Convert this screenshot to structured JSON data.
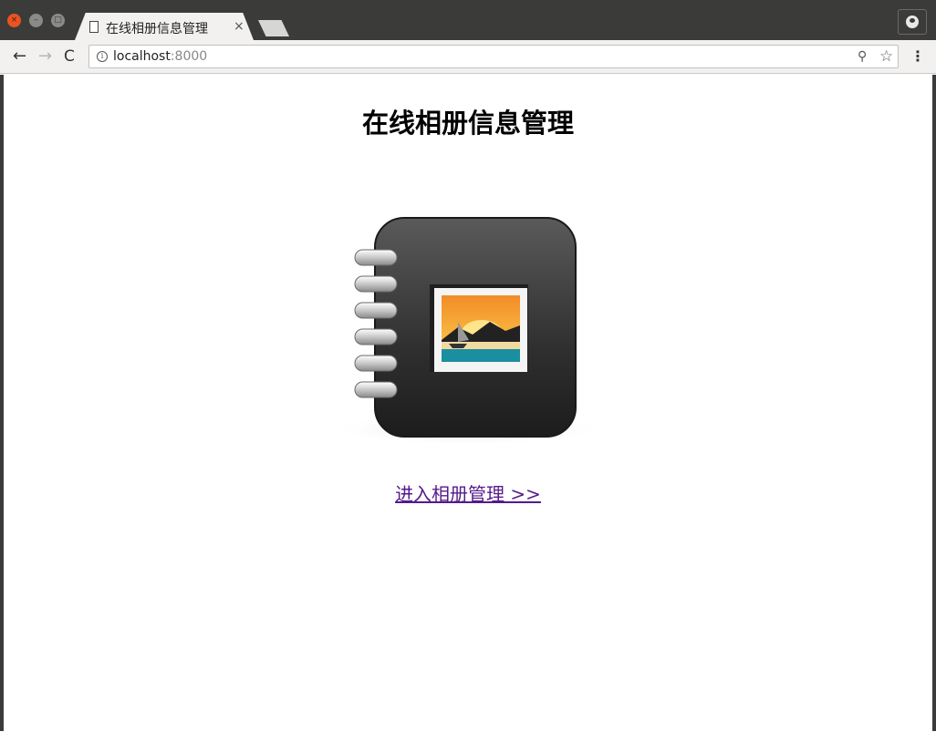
{
  "browser": {
    "tab": {
      "title": "在线相册信息管理",
      "close_glyph": "×"
    },
    "nav": {
      "back_glyph": "←",
      "forward_glyph": "→",
      "reload_glyph": "C"
    },
    "address": {
      "info_glyph": "i",
      "host": "localhost",
      "port": ":8000"
    },
    "icons": {
      "zoom": "zoom-icon",
      "star": "star-icon",
      "menu": "menu-icon"
    },
    "window_controls": {
      "close_glyph": "×",
      "min_glyph": "–",
      "max_glyph": "□"
    }
  },
  "page": {
    "title": "在线相册信息管理",
    "image": {
      "name": "photo-album-icon"
    },
    "link": {
      "label": "进入相册管理 >>"
    }
  },
  "colors": {
    "chrome_dark": "#3b3b3a",
    "toolbar_bg": "#f2f1f0",
    "close_button": "#e95420",
    "visited_link": "#551a8b"
  }
}
